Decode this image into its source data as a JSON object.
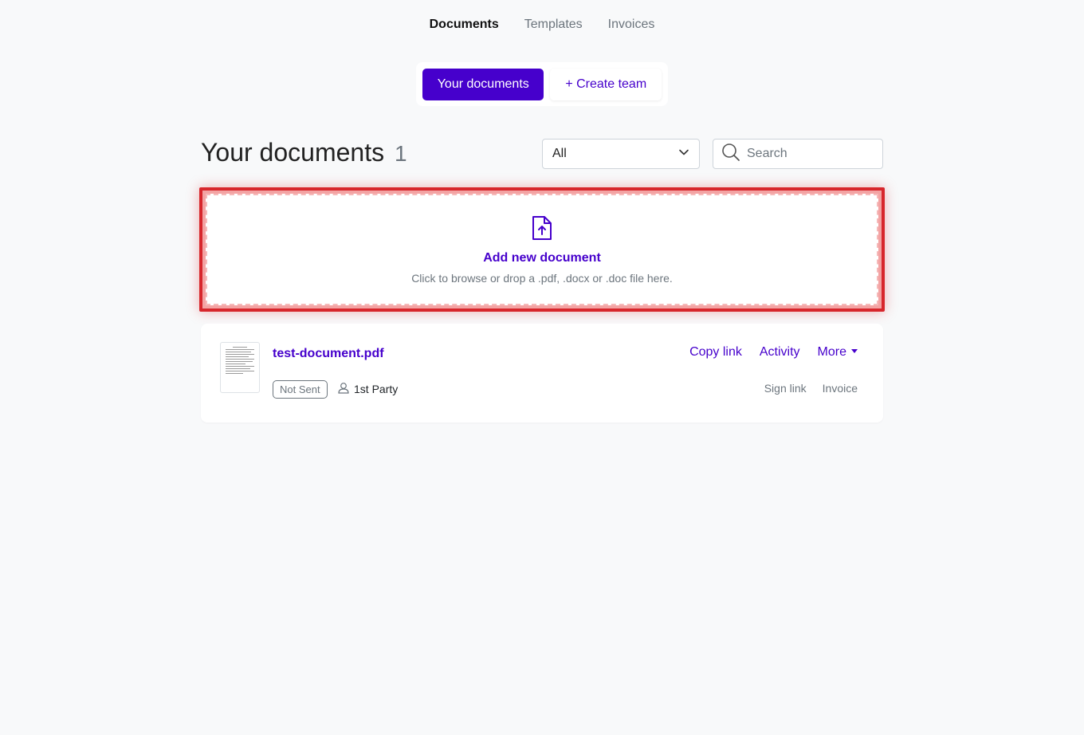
{
  "nav": {
    "tabs": [
      {
        "label": "Documents"
      },
      {
        "label": "Templates"
      },
      {
        "label": "Invoices"
      }
    ]
  },
  "switcher": {
    "primary_label": "Your documents",
    "secondary_label": "+ Create team"
  },
  "page": {
    "title": "Your documents",
    "count": "1"
  },
  "filter": {
    "selected": "All"
  },
  "search": {
    "placeholder": "Search"
  },
  "dropzone": {
    "title": "Add new document",
    "subtitle": "Click to browse or drop a .pdf, .docx or .doc file here.",
    "icon": "file-upload-icon"
  },
  "documents": [
    {
      "name": "test-document.pdf",
      "status": "Not Sent",
      "party": "1st Party",
      "actions": {
        "copy_link": "Copy link",
        "activity": "Activity",
        "more": "More"
      },
      "sub_actions": {
        "sign_link": "Sign link",
        "invoice": "Invoice"
      }
    }
  ],
  "colors": {
    "accent": "#4600cc",
    "highlight": "#d7262c",
    "background": "#f8f9fa"
  }
}
